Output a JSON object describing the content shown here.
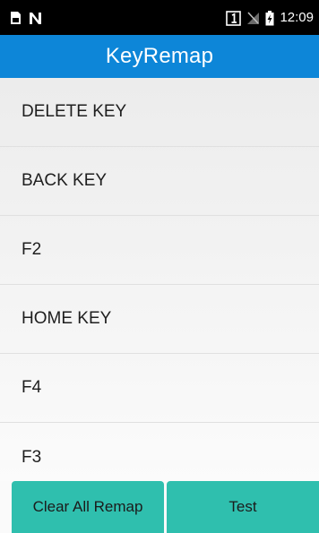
{
  "status_bar": {
    "time": "12:09",
    "icons": [
      "sim-card-icon",
      "no-signal-icon",
      "sim-slot-1-icon",
      "signal-off-icon",
      "battery-charging-icon"
    ]
  },
  "app_bar": {
    "title": "KeyRemap",
    "color": "#0d86d8"
  },
  "key_list": {
    "items": [
      {
        "label": "DELETE KEY"
      },
      {
        "label": "BACK KEY"
      },
      {
        "label": "F2"
      },
      {
        "label": "HOME KEY"
      },
      {
        "label": "F4"
      },
      {
        "label": "F3"
      }
    ]
  },
  "actions": {
    "clear_label": "Clear All Remap",
    "test_label": "Test",
    "button_color": "#2fbfae"
  }
}
